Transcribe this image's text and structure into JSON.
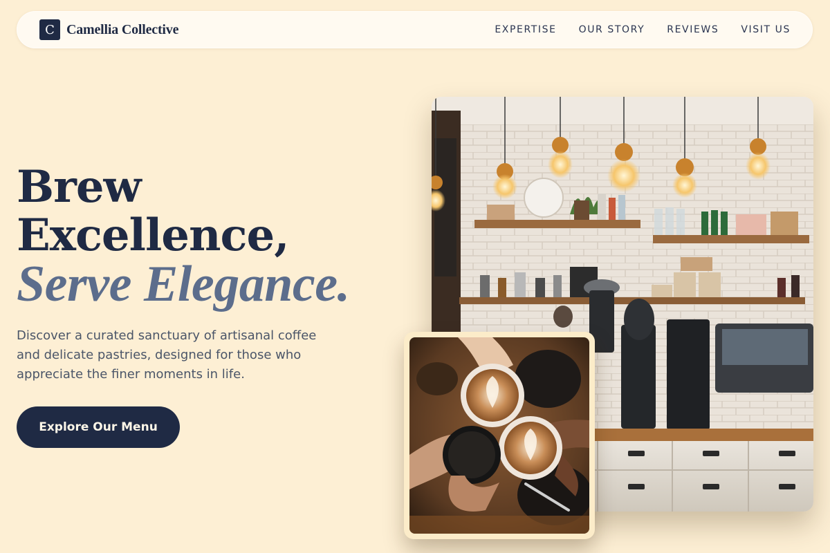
{
  "brand": {
    "mark": "C",
    "name": "Camellia Collective"
  },
  "nav": {
    "links": [
      {
        "label": "EXPERTISE"
      },
      {
        "label": "OUR STORY"
      },
      {
        "label": "REVIEWS"
      },
      {
        "label": "VISIT US"
      }
    ]
  },
  "hero": {
    "headline_line1": "Brew",
    "headline_line2": "Excellence,",
    "headline_accent": "Serve Elegance.",
    "subtext": "Discover a curated sanctuary of artisanal coffee and delicate pastries, designed for those who appreciate the finer moments in life.",
    "cta_label": "Explore Our Menu"
  },
  "colors": {
    "background": "#fdefd4",
    "navy": "#1f2a44",
    "accent_slate": "#5c6d8c",
    "text_muted": "#4a5568"
  },
  "icons": {
    "brand_mark": "logo-monogram-icon"
  }
}
